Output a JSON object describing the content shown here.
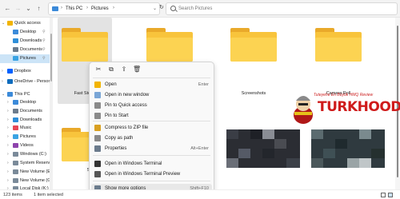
{
  "address": {
    "back_icon": "arrow-left-icon",
    "crumbs": [
      "This PC",
      "Pictures"
    ],
    "search_placeholder": "Search Pictures"
  },
  "sidebar": {
    "items": [
      {
        "label": "Quick access",
        "icon": "star-icon",
        "color": "#f2b400",
        "chev": "v"
      },
      {
        "label": "Desktop",
        "icon": "desktop-icon",
        "color": "#3b8ad9",
        "pin": true
      },
      {
        "label": "Downloads",
        "icon": "download-icon",
        "color": "#2e8ed8",
        "pin": true
      },
      {
        "label": "Documents",
        "icon": "documents-icon",
        "color": "#6b7b8c",
        "pin": true
      },
      {
        "label": "Pictures",
        "icon": "pictures-icon",
        "color": "#3aa3e3",
        "pin": true,
        "selected": true
      },
      {
        "label": "Dropbox",
        "icon": "dropbox-icon",
        "color": "#0061fe",
        "chev": ">"
      },
      {
        "label": "OneDrive - Person",
        "icon": "onedrive-icon",
        "color": "#0f6cbd",
        "chev": ">"
      },
      {
        "label": "This PC",
        "icon": "pc-icon",
        "color": "#3b8ad9",
        "chev": "v"
      },
      {
        "label": "Desktop",
        "icon": "desktop-icon",
        "color": "#3b8ad9",
        "chev": ">"
      },
      {
        "label": "Documents",
        "icon": "documents-icon",
        "color": "#6b7b8c",
        "chev": ">"
      },
      {
        "label": "Downloads",
        "icon": "download-icon",
        "color": "#2e8ed8",
        "chev": ">"
      },
      {
        "label": "Music",
        "icon": "music-icon",
        "color": "#e74856",
        "chev": ">"
      },
      {
        "label": "Pictures",
        "icon": "pictures-icon",
        "color": "#3aa3e3",
        "chev": ">"
      },
      {
        "label": "Videos",
        "icon": "videos-icon",
        "color": "#8e44ad",
        "chev": ">"
      },
      {
        "label": "Windows (C:)",
        "icon": "drive-icon",
        "color": "#7a8a99",
        "chev": ">"
      },
      {
        "label": "System Reservec",
        "icon": "drive-icon",
        "color": "#7a8a99",
        "chev": ">"
      },
      {
        "label": "New Volume (E:)",
        "icon": "drive-icon",
        "color": "#7a8a99",
        "chev": ">"
      },
      {
        "label": "New Volume (G:)",
        "icon": "drive-icon",
        "color": "#7a8a99",
        "chev": ">"
      },
      {
        "label": "Local Disk (K:)",
        "icon": "drive-icon",
        "color": "#7a8a99",
        "chev": ">"
      }
    ]
  },
  "content": {
    "folders": [
      {
        "label": "Fast Stone",
        "selected": true
      },
      {
        "label": ""
      },
      {
        "label": "Screenshots"
      },
      {
        "label": "Camera Roll"
      },
      {
        "label": "Sa"
      }
    ]
  },
  "context_menu": {
    "quick_actions": [
      {
        "icon": "cut-icon",
        "glyph": "✂"
      },
      {
        "icon": "copy-icon",
        "glyph": "⧉"
      },
      {
        "icon": "share-icon",
        "glyph": "⇪"
      },
      {
        "icon": "delete-icon",
        "glyph": "🗑"
      }
    ],
    "items": [
      {
        "label": "Open",
        "shortcut": "Enter",
        "icon": "open-folder-icon",
        "color": "#f2b400"
      },
      {
        "label": "Open in new window",
        "shortcut": "",
        "icon": "new-window-icon",
        "color": "#7aa6d6"
      },
      {
        "label": "Pin to Quick access",
        "shortcut": "",
        "icon": "pin-icon",
        "color": "#8a8a8a"
      },
      {
        "label": "Pin to Start",
        "shortcut": "",
        "icon": "pin-start-icon",
        "color": "#8a8a8a"
      },
      {
        "label": "Compress to ZIP file",
        "shortcut": "",
        "icon": "zip-icon",
        "color": "#d9a021"
      },
      {
        "label": "Copy as path",
        "shortcut": "",
        "icon": "copy-path-icon",
        "color": "#8a8a8a"
      },
      {
        "label": "Properties",
        "shortcut": "Alt+Enter",
        "icon": "properties-icon",
        "color": "#6b7b8c"
      },
      {
        "label": "Open in Windows Terminal",
        "shortcut": "",
        "icon": "terminal-icon",
        "color": "#333333"
      },
      {
        "label": "Open in Windows Terminal Preview",
        "shortcut": "",
        "icon": "terminal-preview-icon",
        "color": "#555555"
      },
      {
        "label": "Show more options",
        "shortcut": "Shift+F10",
        "icon": "more-options-icon",
        "color": "#6b7b8c",
        "hover": true
      }
    ]
  },
  "watermark": {
    "tagline": "Tuteyehe En Büyük HMQ Review",
    "word": "TURKHOOD"
  },
  "status": {
    "count": "123 items",
    "selected": "1 item selected"
  }
}
